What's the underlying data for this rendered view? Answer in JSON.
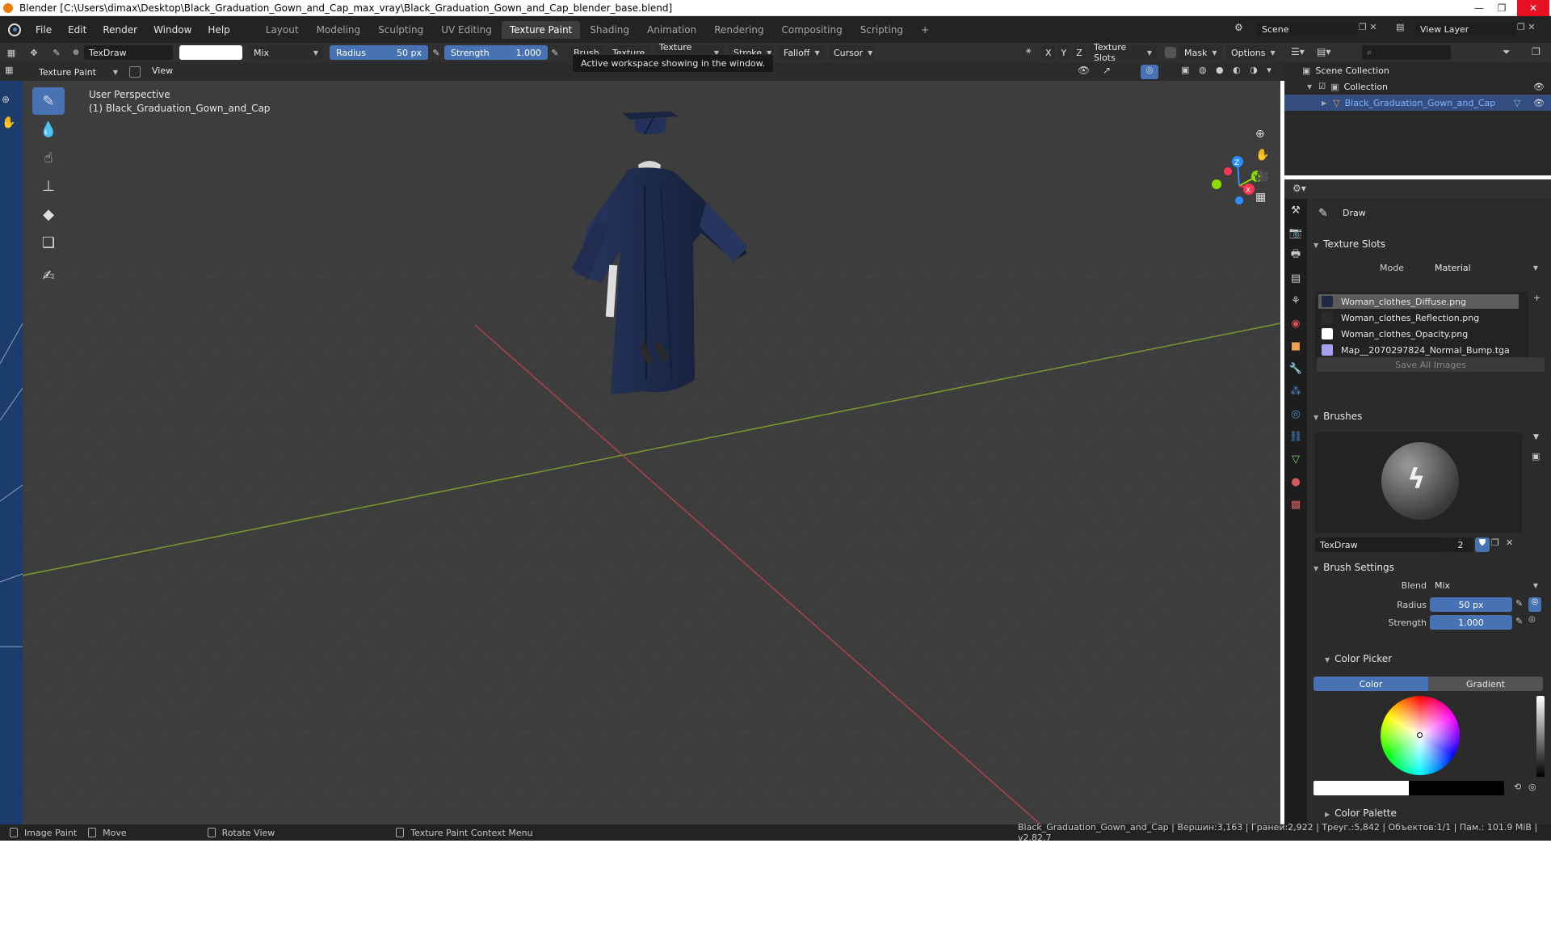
{
  "window": {
    "title": "Blender [C:\\Users\\dimax\\Desktop\\Black_Graduation_Gown_and_Cap_max_vray\\Black_Graduation_Gown_and_Cap_blender_base.blend]",
    "minimize": "—",
    "maximize": "❐",
    "close": "✕"
  },
  "menu": [
    "File",
    "Edit",
    "Render",
    "Window",
    "Help"
  ],
  "workspaces": [
    "Layout",
    "Modeling",
    "Sculpting",
    "UV Editing",
    "Texture Paint",
    "Shading",
    "Animation",
    "Rendering",
    "Compositing",
    "Scripting"
  ],
  "workspace_add": "+",
  "scene": {
    "label": "Scene",
    "view_layer": "View Layer"
  },
  "tool_header": {
    "brush_name": "TexDraw",
    "blend": "Mix",
    "radius_label": "Radius",
    "radius_value": "50 px",
    "strength_label": "Strength",
    "strength_value": "1.000",
    "hidden_items": [
      "Brush",
      "Texture",
      "Texture Mask"
    ],
    "stroke": "Stroke",
    "falloff": "Falloff",
    "cursor": "Cursor",
    "axes": [
      "X",
      "Y",
      "Z"
    ],
    "texture_slots": "Texture Slots",
    "mask": "Mask",
    "options": "Options"
  },
  "sub_header": {
    "mode": "Texture Paint",
    "view": "View"
  },
  "tooltip": "Active workspace showing in the window.",
  "viewport": {
    "perspective": "User Perspective",
    "object": "(1) Black_Graduation_Gown_and_Cap"
  },
  "gizmo": {
    "x": "X",
    "y": "Y",
    "z": "Z"
  },
  "outliner": {
    "scene_collection": "Scene Collection",
    "collection": "Collection",
    "object": "Black_Graduation_Gown_and_Cap"
  },
  "properties": {
    "tool_name": "Draw",
    "texture_slots": {
      "title": "Texture Slots",
      "mode_label": "Mode",
      "mode_value": "Material",
      "slots": [
        {
          "name": "Woman_clothes_Diffuse.png",
          "color": "#1e2a44"
        },
        {
          "name": "Woman_clothes_Reflection.png",
          "color": "#2b2b2b"
        },
        {
          "name": "Woman_clothes_Opacity.png",
          "color": "#ffffff"
        },
        {
          "name": "Map__2070297824_Normal_Bump.tga",
          "color": "#a7a0f0"
        }
      ],
      "save_all": "Save All Images"
    },
    "brushes": {
      "title": "Brushes",
      "brush_name": "TexDraw",
      "users": "2"
    },
    "brush_settings": {
      "title": "Brush Settings",
      "blend_label": "Blend",
      "blend_value": "Mix",
      "radius_label": "Radius",
      "radius_value": "50 px",
      "strength_label": "Strength",
      "strength_value": "1.000"
    },
    "color_picker": {
      "title": "Color Picker",
      "tab_color": "Color",
      "tab_gradient": "Gradient"
    },
    "color_palette": {
      "title": "Color Palette"
    }
  },
  "status": {
    "image_paint": "Image Paint",
    "move": "Move",
    "rotate_view": "Rotate View",
    "context_menu": "Texture Paint Context Menu",
    "stats": "Black_Graduation_Gown_and_Cap | Вершин:3,163 | Граней:2,922 | Треуг.:5,842 | Объектов:1/1 | Пам.: 101.9 MiB | v2.82.7"
  },
  "colors": {
    "accent": "#4772b3",
    "active_selection": "#334d80",
    "x_axis": "#ff3352",
    "y_axis": "#8bdc00",
    "z_axis": "#2890ff",
    "gown": "#1b2848"
  }
}
